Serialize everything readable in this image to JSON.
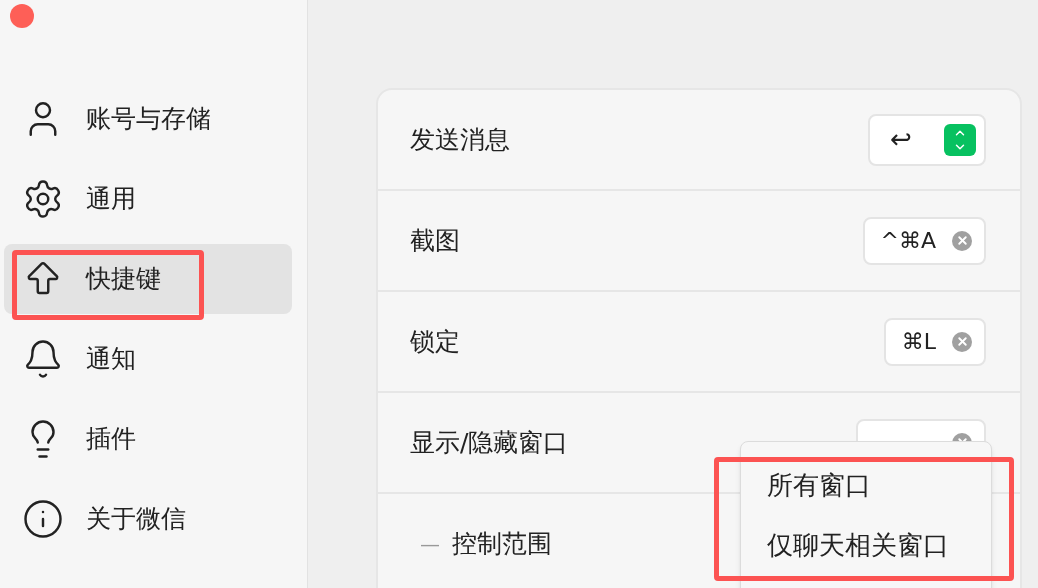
{
  "sidebar": {
    "items": [
      {
        "label": "账号与存储",
        "selected": false,
        "highlighted": false
      },
      {
        "label": "通用",
        "selected": false,
        "highlighted": false
      },
      {
        "label": "快捷键",
        "selected": true,
        "highlighted": true
      },
      {
        "label": "通知",
        "selected": false,
        "highlighted": false
      },
      {
        "label": "插件",
        "selected": false,
        "highlighted": false
      },
      {
        "label": "关于微信",
        "selected": false,
        "highlighted": false
      }
    ]
  },
  "shortcuts": [
    {
      "label": "发送消息",
      "kind": "select",
      "value": "↩"
    },
    {
      "label": "截图",
      "kind": "key",
      "value": "^⌘A"
    },
    {
      "label": "锁定",
      "kind": "key",
      "value": "⌘L"
    },
    {
      "label": "显示/隐藏窗口",
      "kind": "key"
    }
  ],
  "sub_setting": {
    "marker": "—",
    "label": "控制范围"
  },
  "dropdown": {
    "highlighted": true,
    "options": [
      {
        "label": "所有窗口"
      },
      {
        "label": "仅聊天相关窗口"
      }
    ]
  }
}
